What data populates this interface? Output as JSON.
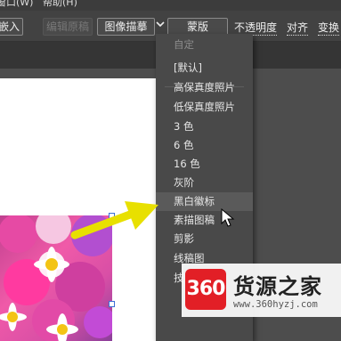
{
  "menubar": {
    "window_menu": "窗口(W)",
    "help_menu": "帮助(H)"
  },
  "toolbar": {
    "embed_label": "嵌入",
    "edit_original_label": "编辑原稿",
    "image_trace_label": "图像描摹",
    "dropdown_arrow": "chevron-down-icon",
    "mask_label": "蒙版",
    "opacity_label": "不透明度",
    "align_label": "对齐",
    "transform_label": "变换"
  },
  "trace_menu": {
    "header": "自定",
    "items": [
      "[默认]",
      "高保真度照片",
      "低保真度照片",
      "3 色",
      "6 色",
      "16 色",
      "灰阶",
      "黑白徽标",
      "素描图稿",
      "剪影",
      "线稿图",
      "技"
    ],
    "highlighted_index": 7
  },
  "watermark": {
    "logo_text": "360",
    "title": "货源之家",
    "url": "www.360hyzj.com"
  },
  "colors": {
    "accent_arrow": "#e8e000",
    "watermark_red": "#e21f26"
  }
}
